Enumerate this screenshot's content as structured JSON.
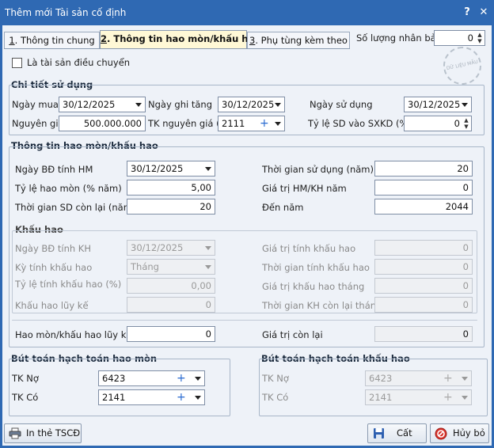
{
  "window": {
    "title": "Thêm mới Tài sản cố định",
    "help_glyph": "?",
    "close_glyph": "✕"
  },
  "tabs": [
    {
      "key": "1",
      "rest": ". Thông tin chung"
    },
    {
      "key": "2",
      "rest": ". Thông tin hao mòn/khấu hao"
    },
    {
      "key": "3",
      "rest": ". Phụ tùng kèm theo"
    }
  ],
  "staff_count": {
    "label": "Số lượng nhân bản",
    "value": "0"
  },
  "transfer": {
    "label": "Là tài sản điều chuyển",
    "checked": false
  },
  "stamp": "DỮ LIỆU MẪU",
  "usage": {
    "title": "Chi tiết sử dụng",
    "purchase_date": {
      "label": "Ngày mua",
      "value": "30/12/2025"
    },
    "record_date": {
      "label": "Ngày ghi tăng",
      "value": "30/12/2025"
    },
    "use_date": {
      "label": "Ngày sử dụng",
      "value": "30/12/2025"
    },
    "cost": {
      "label": "Nguyên giá",
      "value": "500.000.000"
    },
    "cost_account": {
      "label": "TK nguyên giá (*)",
      "value": "2111"
    },
    "business_ratio": {
      "label": "Tỷ lệ SD vào SXKD (%)",
      "value": "0"
    }
  },
  "depreciation": {
    "title": "Thông tin hao mòn/khấu hao",
    "start_date": {
      "label": "Ngày BĐ tính HM",
      "value": "30/12/2025"
    },
    "life_years": {
      "label": "Thời gian sử dụng (năm)",
      "value": "20"
    },
    "rate": {
      "label": "Tỷ lệ hao mòn (% năm)",
      "value": "5,00"
    },
    "annual_value": {
      "label": "Giá trị HM/KH năm",
      "value": "0"
    },
    "remaining_years": {
      "label": "Thời gian SD còn lại (năm)",
      "value": "20"
    },
    "end_year": {
      "label": "Đến năm",
      "value": "2044"
    },
    "accumulated": {
      "label": "Hao mòn/khấu hao lũy kế",
      "value": "0"
    },
    "residual": {
      "label": "Giá trị còn lại",
      "value": "0"
    }
  },
  "amortization": {
    "title": "Khấu hao",
    "start_date": {
      "label": "Ngày BĐ tính KH",
      "value": "30/12/2025"
    },
    "base_value": {
      "label": "Giá trị tính khấu hao",
      "value": "0"
    },
    "period": {
      "label": "Kỳ tính khấu hao",
      "value": "Tháng"
    },
    "duration": {
      "label": "Thời gian tính khấu hao",
      "value": "0"
    },
    "rate": {
      "label": "Tỷ lệ tính khấu hao (%)",
      "value": "0,00"
    },
    "monthly_value": {
      "label": "Giá trị khấu hao tháng",
      "value": "0"
    },
    "accumulated": {
      "label": "Khấu hao lũy kế",
      "value": "0"
    },
    "remaining_months": {
      "label": "Thời gian KH còn lại tháng",
      "value": "0"
    }
  },
  "wear_entry": {
    "title": "Bút toán hạch toán hao mòn",
    "debit": {
      "label": "TK Nợ",
      "value": "6423"
    },
    "credit": {
      "label": "TK Có",
      "value": "2141"
    }
  },
  "amort_entry": {
    "title": "Bút toán hạch toán khấu hao",
    "debit": {
      "label": "TK Nợ",
      "value": "6423"
    },
    "credit": {
      "label": "TK Có",
      "value": "2141"
    }
  },
  "buttons": {
    "print": "In thẻ TSCĐ",
    "cut": "Cất",
    "cancel": "Hủy bỏ"
  },
  "colors": {
    "titlebar": "#2f69b3",
    "active_tab": "#fff8d6",
    "accent_plus": "#2a6bd1"
  }
}
